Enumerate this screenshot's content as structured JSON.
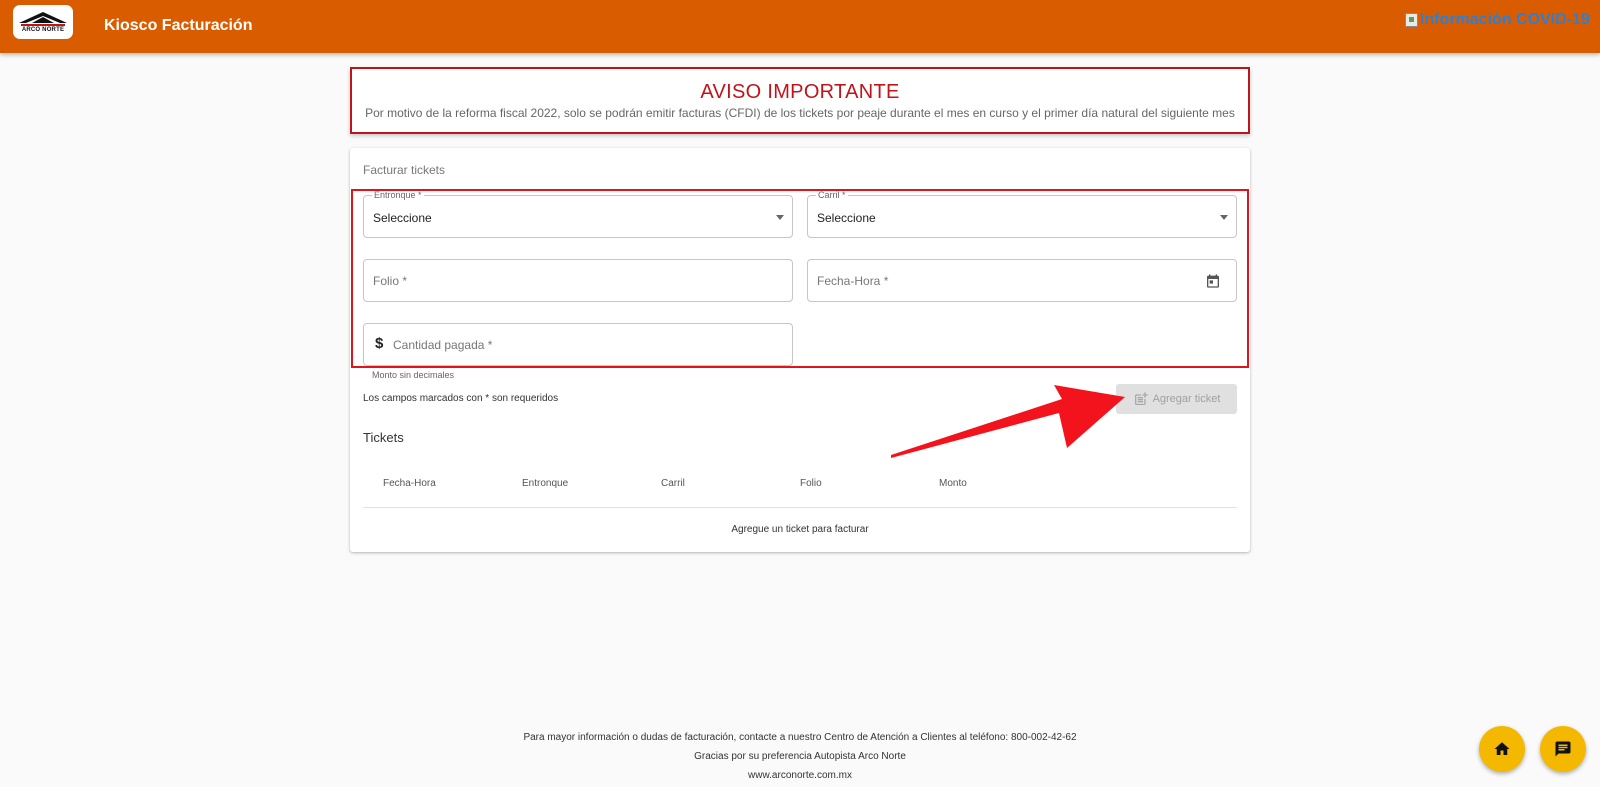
{
  "header": {
    "title": "Kiosco Facturación",
    "logo_text": "ARCO NORTE",
    "covid_link": "Información COVID-19"
  },
  "notice": {
    "title": "AVISO IMPORTANTE",
    "text": "Por motivo de la reforma fiscal 2022, solo se podrán emitir facturas (CFDI) de los tickets por peaje durante el mes en curso y el primer día natural del siguiente mes"
  },
  "form": {
    "title": "Facturar tickets",
    "entronque": {
      "label": "Entronque *",
      "value": "Seleccione"
    },
    "carril": {
      "label": "Carril *",
      "value": "Seleccione"
    },
    "folio": {
      "placeholder": "Folio *"
    },
    "fecha_hora": {
      "placeholder": "Fecha-Hora *"
    },
    "cantidad": {
      "placeholder": "Cantidad pagada *",
      "prefix": "$",
      "hint": "Monto sin decimales"
    },
    "required_note": "Los campos marcados con * son requeridos",
    "add_button": "Agregar ticket"
  },
  "tickets": {
    "title": "Tickets",
    "columns": [
      "Fecha-Hora",
      "Entronque",
      "Carril",
      "Folio",
      "Monto"
    ],
    "empty_text": "Agregue un ticket para facturar"
  },
  "footer": {
    "line1": "Para mayor información o dudas de facturación, contacte a nuestro Centro de Atención a Clientes al teléfono: 800-002-42-62",
    "line2": "Gracias por su preferencia Autopista Arco Norte",
    "line3": "www.arconorte.com.mx"
  },
  "colors": {
    "header_bg": "#d95d00",
    "notice_red": "#c0141b",
    "fab": "#f5b800"
  },
  "icons": {
    "home_fab": "home-icon",
    "chat_fab": "chat-icon",
    "calendar": "calendar-icon",
    "add_ticket": "post-add-icon"
  }
}
